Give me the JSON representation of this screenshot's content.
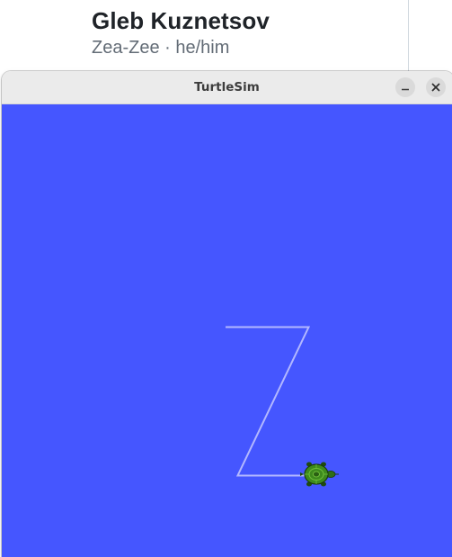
{
  "background_page": {
    "name": "Gleb Kuznetsov",
    "subtitle": "Zea-Zee · he/him"
  },
  "window": {
    "title": "TurtleSim",
    "minimize_icon": "minimize-icon",
    "close_icon": "close-icon"
  },
  "canvas": {
    "background_color": "#4556ff",
    "pen_color": "#b3b8ff",
    "turtle_color": "#3e8a1d",
    "turtle_heading": "east"
  }
}
